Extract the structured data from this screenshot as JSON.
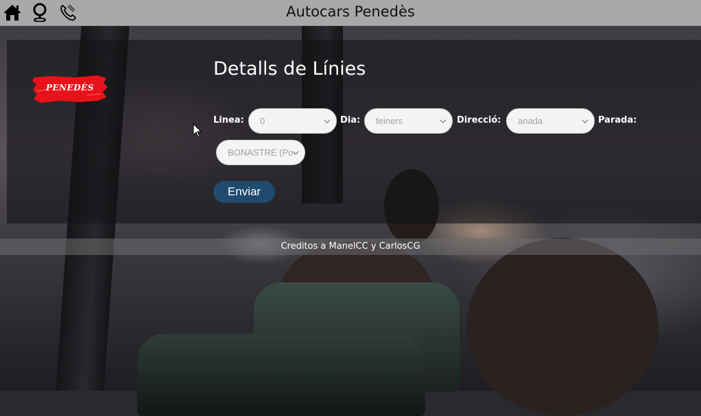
{
  "navbar": {
    "title": "Autocars Penedès",
    "icons": [
      "home-icon",
      "map-pin-icon",
      "phone-icon"
    ]
  },
  "logo": {
    "text": "PENEDÈS",
    "color": "#e8121a"
  },
  "page": {
    "title": "Detalls de Línies"
  },
  "form": {
    "linea": {
      "label": "Linea:",
      "value": "0"
    },
    "dia": {
      "label": "Dia:",
      "value": "feiners"
    },
    "direccio": {
      "label": "Direcció:",
      "value": "anada"
    },
    "parada": {
      "label": "Parada:",
      "value": "BONASTRE (Po"
    },
    "submit_label": "Enviar"
  },
  "footer": {
    "credits": "Creditos a ManelCC y CarlosCG"
  },
  "colors": {
    "navbar": "#a8a8a8",
    "button": "#1f4a6e",
    "panel": "rgba(20,20,22,0.62)"
  }
}
